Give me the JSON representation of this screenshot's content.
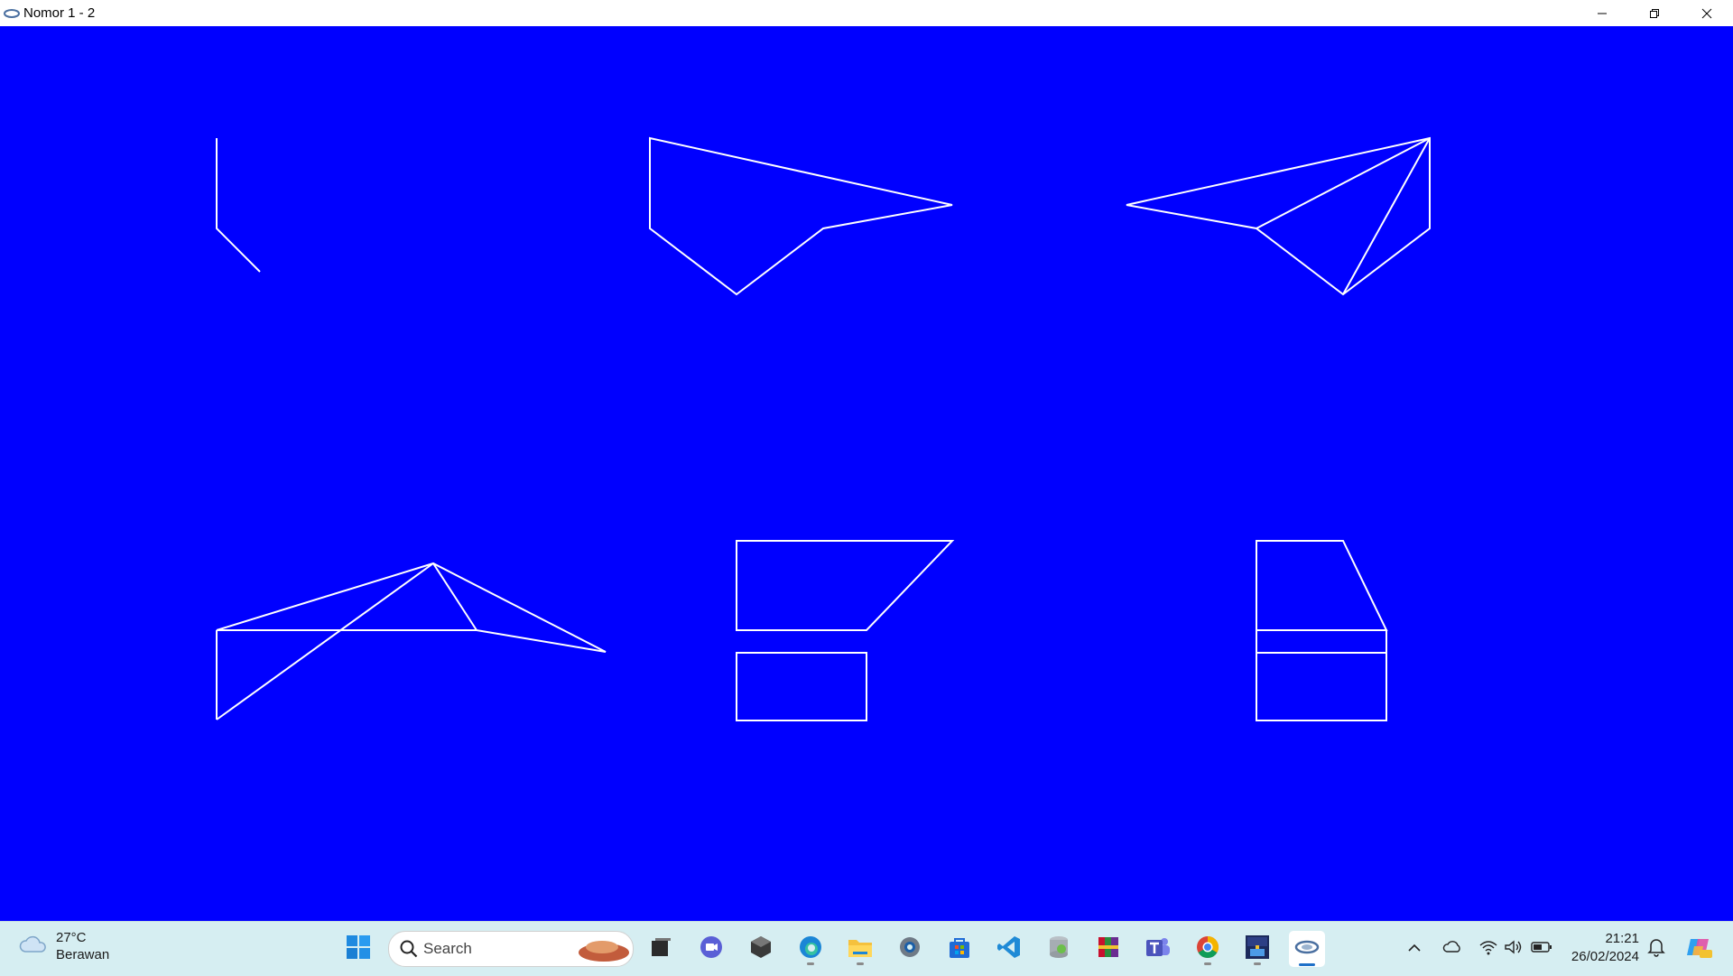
{
  "window": {
    "title": "Nomor 1 - 2"
  },
  "taskbar": {
    "weather": {
      "temperature": "27°C",
      "condition": "Berawan"
    },
    "search": {
      "label": "Search"
    },
    "apps": [
      "start",
      "search",
      "task-view",
      "meet",
      "app-cube",
      "edge",
      "file-explorer",
      "settings",
      "store",
      "vscode",
      "app-gray",
      "winrar",
      "teams",
      "chrome",
      "devcpp",
      "opengl-app"
    ],
    "tray": [
      "chevron-up",
      "onedrive",
      "wifi",
      "volume",
      "battery"
    ],
    "clock": {
      "time": "21:21",
      "date": "26/02/2024"
    }
  },
  "colors": {
    "canvas": "#0000ff",
    "lines": "#ffffff",
    "taskbar": "#d6eef2"
  }
}
